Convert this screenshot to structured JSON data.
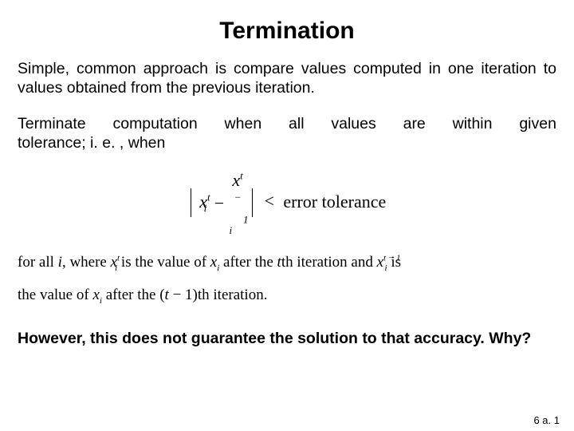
{
  "title": "Termination",
  "para1": "Simple, common approach is compare values computed in one iteration to values obtained from the previous iteration.",
  "para2_line1_words": [
    "Terminate",
    "computation",
    "when",
    "all",
    "values",
    "are",
    "within",
    "given"
  ],
  "para2_line2": "tolerance; i. e. , when",
  "formula": {
    "var": "x",
    "sub": "i",
    "sup1": "t",
    "minus": "−",
    "sup2": "t − 1",
    "lt": "<",
    "rhs": "error tolerance"
  },
  "line2": {
    "prefix": "for all ",
    "i": "i",
    "mid1": ", where ",
    "mid2": " is the value of ",
    "x_i": "x",
    "sub_i": "i",
    "after": " after the ",
    "t": "t",
    "th": "th iteration and ",
    "is": " is"
  },
  "line3": {
    "prefix": "the value of ",
    "after": " after the (",
    "t": "t",
    "minus1": " − 1)th iteration."
  },
  "question": "However, this does not guarantee the solution to that accuracy.  Why?",
  "pagenum": "6 a. 1"
}
